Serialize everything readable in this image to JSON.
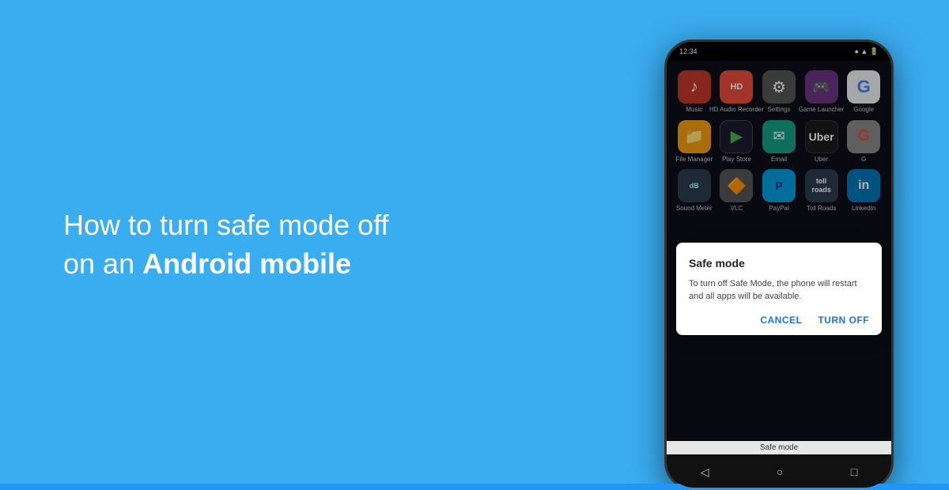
{
  "left": {
    "headline_normal": "How to turn safe mode off",
    "headline_normal2": "on an ",
    "headline_bold": "Android mobile"
  },
  "phone": {
    "status_time": "12:34",
    "status_icons": "▲ WiFi 🔋",
    "rows": [
      [
        {
          "label": "Music",
          "icon": "music",
          "emoji": "🎵",
          "bg": "#c0392b"
        },
        {
          "label": "HD Audio\nRecorder",
          "icon": "hd-audio",
          "emoji": "🎙",
          "bg": "#e74c3c"
        },
        {
          "label": "Settings",
          "icon": "settings",
          "emoji": "⚙",
          "bg": "#555"
        },
        {
          "label": "Game\nLauncher",
          "icon": "game",
          "emoji": "🎮",
          "bg": "#6c3483"
        },
        {
          "label": "Google",
          "icon": "google",
          "emoji": "G",
          "bg": "#ecf0f1"
        }
      ],
      [
        {
          "label": "File\nManager",
          "icon": "file-manager",
          "emoji": "📁",
          "bg": "#f39c12"
        },
        {
          "label": "Play Store",
          "icon": "play-store",
          "emoji": "▶",
          "bg": "#1a1a2e"
        },
        {
          "label": "Email",
          "icon": "email",
          "emoji": "✉",
          "bg": "#16a085"
        },
        {
          "label": "Uber",
          "icon": "uber",
          "emoji": "U",
          "bg": "#1a1a2e"
        },
        {
          "label": "G",
          "icon": "grammarly",
          "emoji": "G",
          "bg": "#555"
        }
      ],
      [
        {
          "label": "Sound\nMeter",
          "icon": "sound-meter",
          "emoji": "dB",
          "bg": "#2c3e50"
        },
        {
          "label": "VLC",
          "icon": "vlc",
          "emoji": "🔶",
          "bg": "#555"
        },
        {
          "label": "PayPal",
          "icon": "paypal",
          "emoji": "P",
          "bg": "#2c3e50"
        },
        {
          "label": "Toll Roads",
          "icon": "toll-roads",
          "emoji": "🛣",
          "bg": "#2c3e50"
        },
        {
          "label": "LinkedIn",
          "icon": "linkedin",
          "emoji": "in",
          "bg": "#0077b5"
        }
      ]
    ],
    "dialog": {
      "title": "Safe mode",
      "body": "To turn off Safe Mode, the phone will restart and all apps will be available.",
      "cancel_label": "Cancel",
      "turn_off_label": "Turn off"
    },
    "safe_mode_label": "Safe mode",
    "nav": [
      "◁",
      "○",
      "□"
    ]
  }
}
